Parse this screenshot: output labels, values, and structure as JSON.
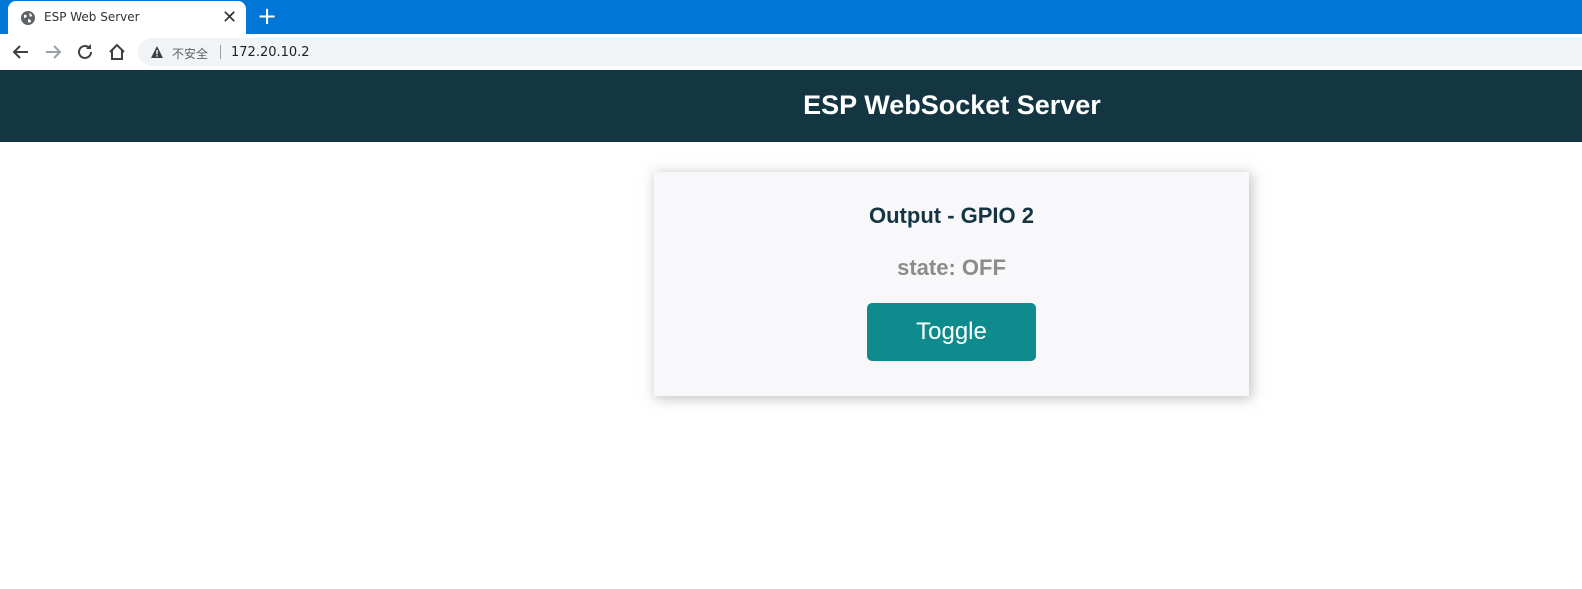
{
  "browser": {
    "tab": {
      "title": "ESP Web Server",
      "close": "✕",
      "icon": "globe-icon"
    },
    "new_tab": "+",
    "toolbar": {
      "back_icon": "arrow-left-icon",
      "forward_icon": "arrow-right-icon",
      "reload_icon": "reload-icon",
      "home_icon": "home-icon"
    },
    "omnibox": {
      "security_icon": "warning-icon",
      "security_label": "不安全",
      "url": "172.20.10.2"
    },
    "accent_color": "#0077d6"
  },
  "page": {
    "header": {
      "title": "ESP WebSocket Server",
      "background": "#143642"
    },
    "card": {
      "title": "Output - GPIO 2",
      "state_text": "state: OFF",
      "button_label": "Toggle",
      "button_color": "#0f8b8d"
    }
  }
}
